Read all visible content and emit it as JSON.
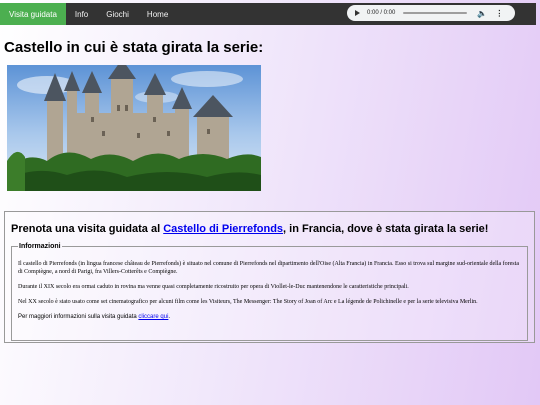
{
  "nav": {
    "items": [
      {
        "label": "Visita guidata",
        "active": true
      },
      {
        "label": "Info",
        "active": false
      },
      {
        "label": "Giochi",
        "active": false
      },
      {
        "label": "Home",
        "active": false
      }
    ]
  },
  "audio": {
    "time": "0:00 / 0:00",
    "play_icon": "play-icon",
    "volume_icon": "volume-icon",
    "menu_icon": "more-vert-icon"
  },
  "page": {
    "title": "Castello in cui è stata girata la serie:"
  },
  "visit": {
    "title_prefix": "Prenota una visita guidata al ",
    "title_link": "Castello di Pierrefonds",
    "title_suffix": ", in Francia, dove è stata girata la serie!",
    "legend": "Informazioni",
    "paragraph_1": "Il castello di Pierrefonds (in lingua francese château de Pierrefonds) è situato nel comune di Pierrefonds nel dipartimento dell'Oise (Alta Francia) in Francia. Esso si trova sul margine sud-orientale della foresta di Compiègne, a nord di Parigi, fra Villers-Cotterêts e Compiègne.",
    "paragraph_2": "Durante il XIX secolo era ormai caduto in rovina ma venne quasi completamente ricostruito per opera di Viollet-le-Duc mantenendone le caratteristiche principali.",
    "paragraph_3": "Nel XX secolo è stato usato come set cinematografico per alcuni film come les Visiteurs, The Messenger: The Story of Joan of Arc e La légende de Polichinelle e per la serie televisiva Merlin.",
    "more_prefix": "Per maggiori informazioni sulla visita guidata ",
    "more_link": "cliccare qui",
    "more_suffix": "."
  },
  "colors": {
    "navbar": "#333333",
    "active_tab": "#4caf50",
    "link": "#0000ee"
  }
}
